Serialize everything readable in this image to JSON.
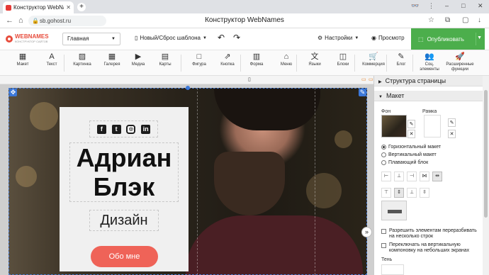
{
  "browser": {
    "tab_title": "Конструктор WebNam",
    "new_tab": "+",
    "url": "sb.gohost.ru",
    "window_title": "Конструктор WebNames"
  },
  "topbar": {
    "logo_text": "WEBNAMES",
    "logo_sub": "КОНСТРУКТОР САЙТОВ",
    "page_select": "Главная",
    "template_btn": "Новый/Сброс шаблона",
    "settings_btn": "Настройки",
    "preview_btn": "Просмотр",
    "publish_btn": "Опубликовать"
  },
  "tools": [
    {
      "label": "Макет",
      "icon": "▦"
    },
    {
      "label": "Текст",
      "icon": "A"
    },
    {
      "label": "Картинка",
      "icon": "▨"
    },
    {
      "label": "Галерея",
      "icon": "▦"
    },
    {
      "label": "Медиа",
      "icon": "▶"
    },
    {
      "label": "Карты",
      "icon": "▤"
    },
    {
      "label": "Фигура",
      "icon": "□"
    },
    {
      "label": "Кнопка",
      "icon": "⇗"
    },
    {
      "label": "Форма",
      "icon": "▥"
    },
    {
      "label": "Меню",
      "icon": "⌂"
    },
    {
      "label": "Языки",
      "icon": "文"
    },
    {
      "label": "Блоки",
      "icon": "◫"
    },
    {
      "label": "Коммерция",
      "icon": "🛒"
    },
    {
      "label": "Блог",
      "icon": "✎"
    },
    {
      "label": "Соц. элементы",
      "icon": "👥"
    },
    {
      "label": "Расширенные функции",
      "icon": "🚀"
    }
  ],
  "hero": {
    "name": "Адриан Блэк",
    "role": "Дизайн",
    "cta": "Обо мне",
    "socials": [
      "f",
      "t",
      "◎",
      "in"
    ]
  },
  "panel": {
    "structure_title": "Структура страницы",
    "layout_title": "Макет",
    "bg_label": "Фон",
    "border_label": "Рамка",
    "radio_options": [
      {
        "label": "Горизонтальный макет",
        "checked": true
      },
      {
        "label": "Вертикальный макет",
        "checked": false
      },
      {
        "label": "Плавающий блок",
        "checked": false
      }
    ],
    "check_wrap": "Разрешить элементам переразбивать на несколько строк",
    "check_vertical": "Переключать на вертикальную компоновку на небольших экранах",
    "shadow_label": "Тень"
  },
  "colors": {
    "publish": "#4cae4c",
    "cta": "#ef6358",
    "accent": "#3c78d8",
    "logo": "#e74c3c"
  }
}
